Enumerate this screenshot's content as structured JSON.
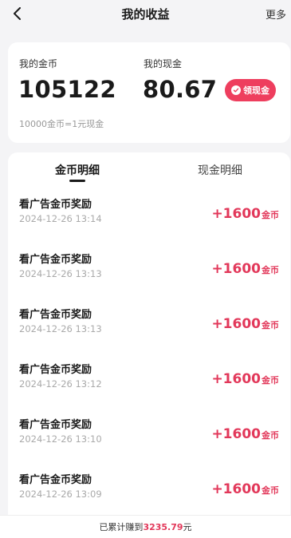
{
  "header": {
    "title": "我的收益",
    "more_label": "更多"
  },
  "summary": {
    "coins_label": "我的金币",
    "coins_value": "105122",
    "cash_label": "我的现金",
    "cash_value": "80.67",
    "withdraw_label": "领现金",
    "rate_text": "10000金币=1元现金"
  },
  "tabs": [
    {
      "label": "金币明细",
      "active": true
    },
    {
      "label": "现金明细",
      "active": false
    }
  ],
  "records": [
    {
      "title": "看广告金币奖励",
      "time": "2024-12-26 13:14",
      "amount": "+1600",
      "unit": "金币"
    },
    {
      "title": "看广告金币奖励",
      "time": "2024-12-26 13:13",
      "amount": "+1600",
      "unit": "金币"
    },
    {
      "title": "看广告金币奖励",
      "time": "2024-12-26 13:13",
      "amount": "+1600",
      "unit": "金币"
    },
    {
      "title": "看广告金币奖励",
      "time": "2024-12-26 13:12",
      "amount": "+1600",
      "unit": "金币"
    },
    {
      "title": "看广告金币奖励",
      "time": "2024-12-26 13:10",
      "amount": "+1600",
      "unit": "金币"
    },
    {
      "title": "看广告金币奖励",
      "time": "2024-12-26 13:09",
      "amount": "+1600",
      "unit": "金币"
    }
  ],
  "footer": {
    "prefix": "已累计赚到",
    "total": "3235.79",
    "suffix": "元"
  },
  "colors": {
    "accent": "#e2385a",
    "button": "#ee3e5e"
  }
}
